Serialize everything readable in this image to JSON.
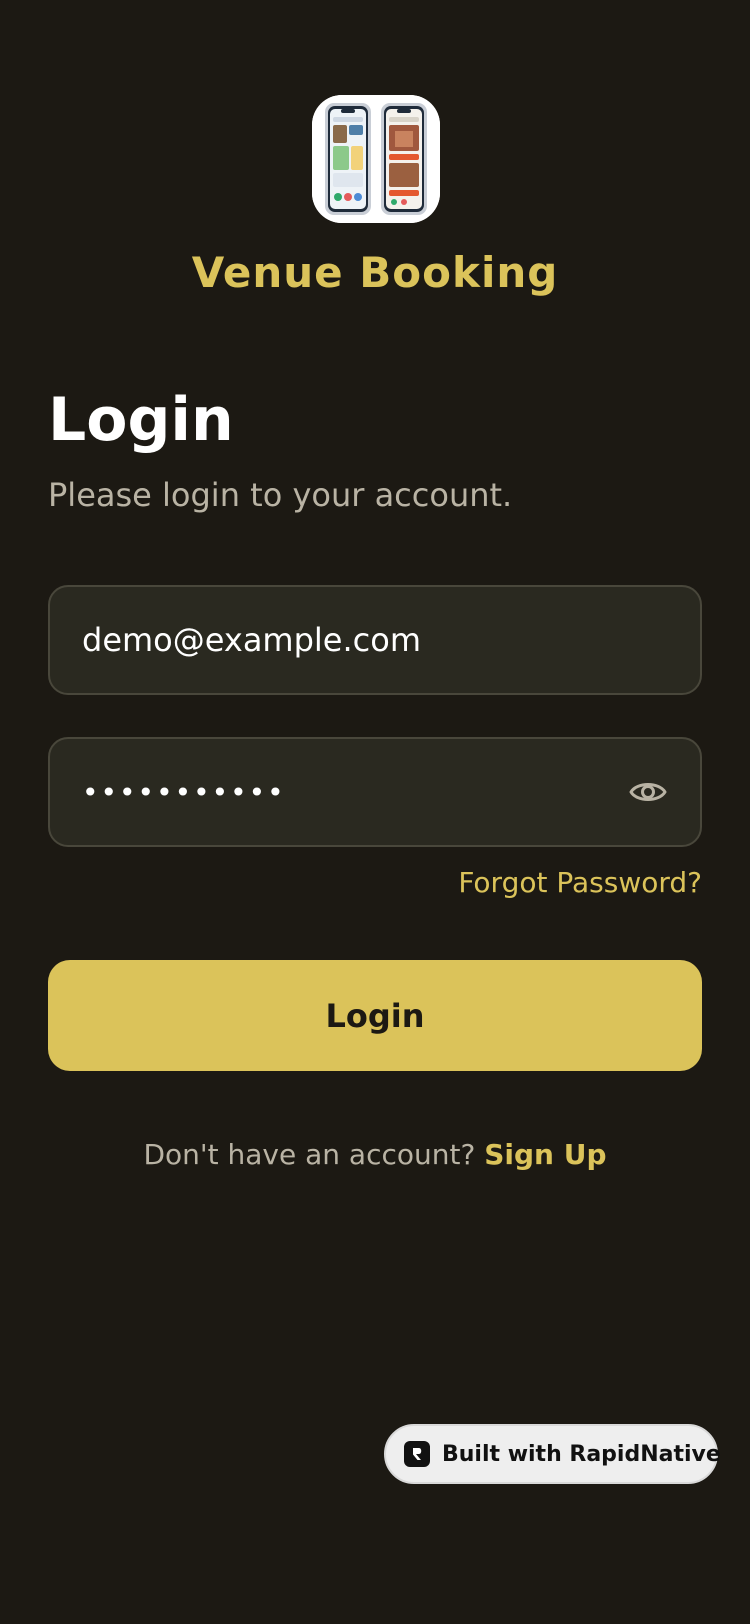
{
  "app": {
    "name": "Venue Booking",
    "logo_icon": "phones-logo-icon"
  },
  "login": {
    "title": "Login",
    "subtitle": "Please login to your account.",
    "email_value": "demo@example.com",
    "password_value": "•••••••••••",
    "show_password_icon": "eye-icon",
    "forgot_password_label": "Forgot Password?",
    "submit_label": "Login"
  },
  "signup": {
    "prompt": "Don't have an account?",
    "link_label": "Sign Up"
  },
  "badge": {
    "label": "Built with RapidNative",
    "icon": "rapidnative-logo-icon"
  },
  "colors": {
    "background": "#1c1913",
    "accent": "#dbc35a",
    "field_bg": "#2a2920",
    "field_border": "#49473b",
    "muted_text": "#b9b3a4"
  }
}
